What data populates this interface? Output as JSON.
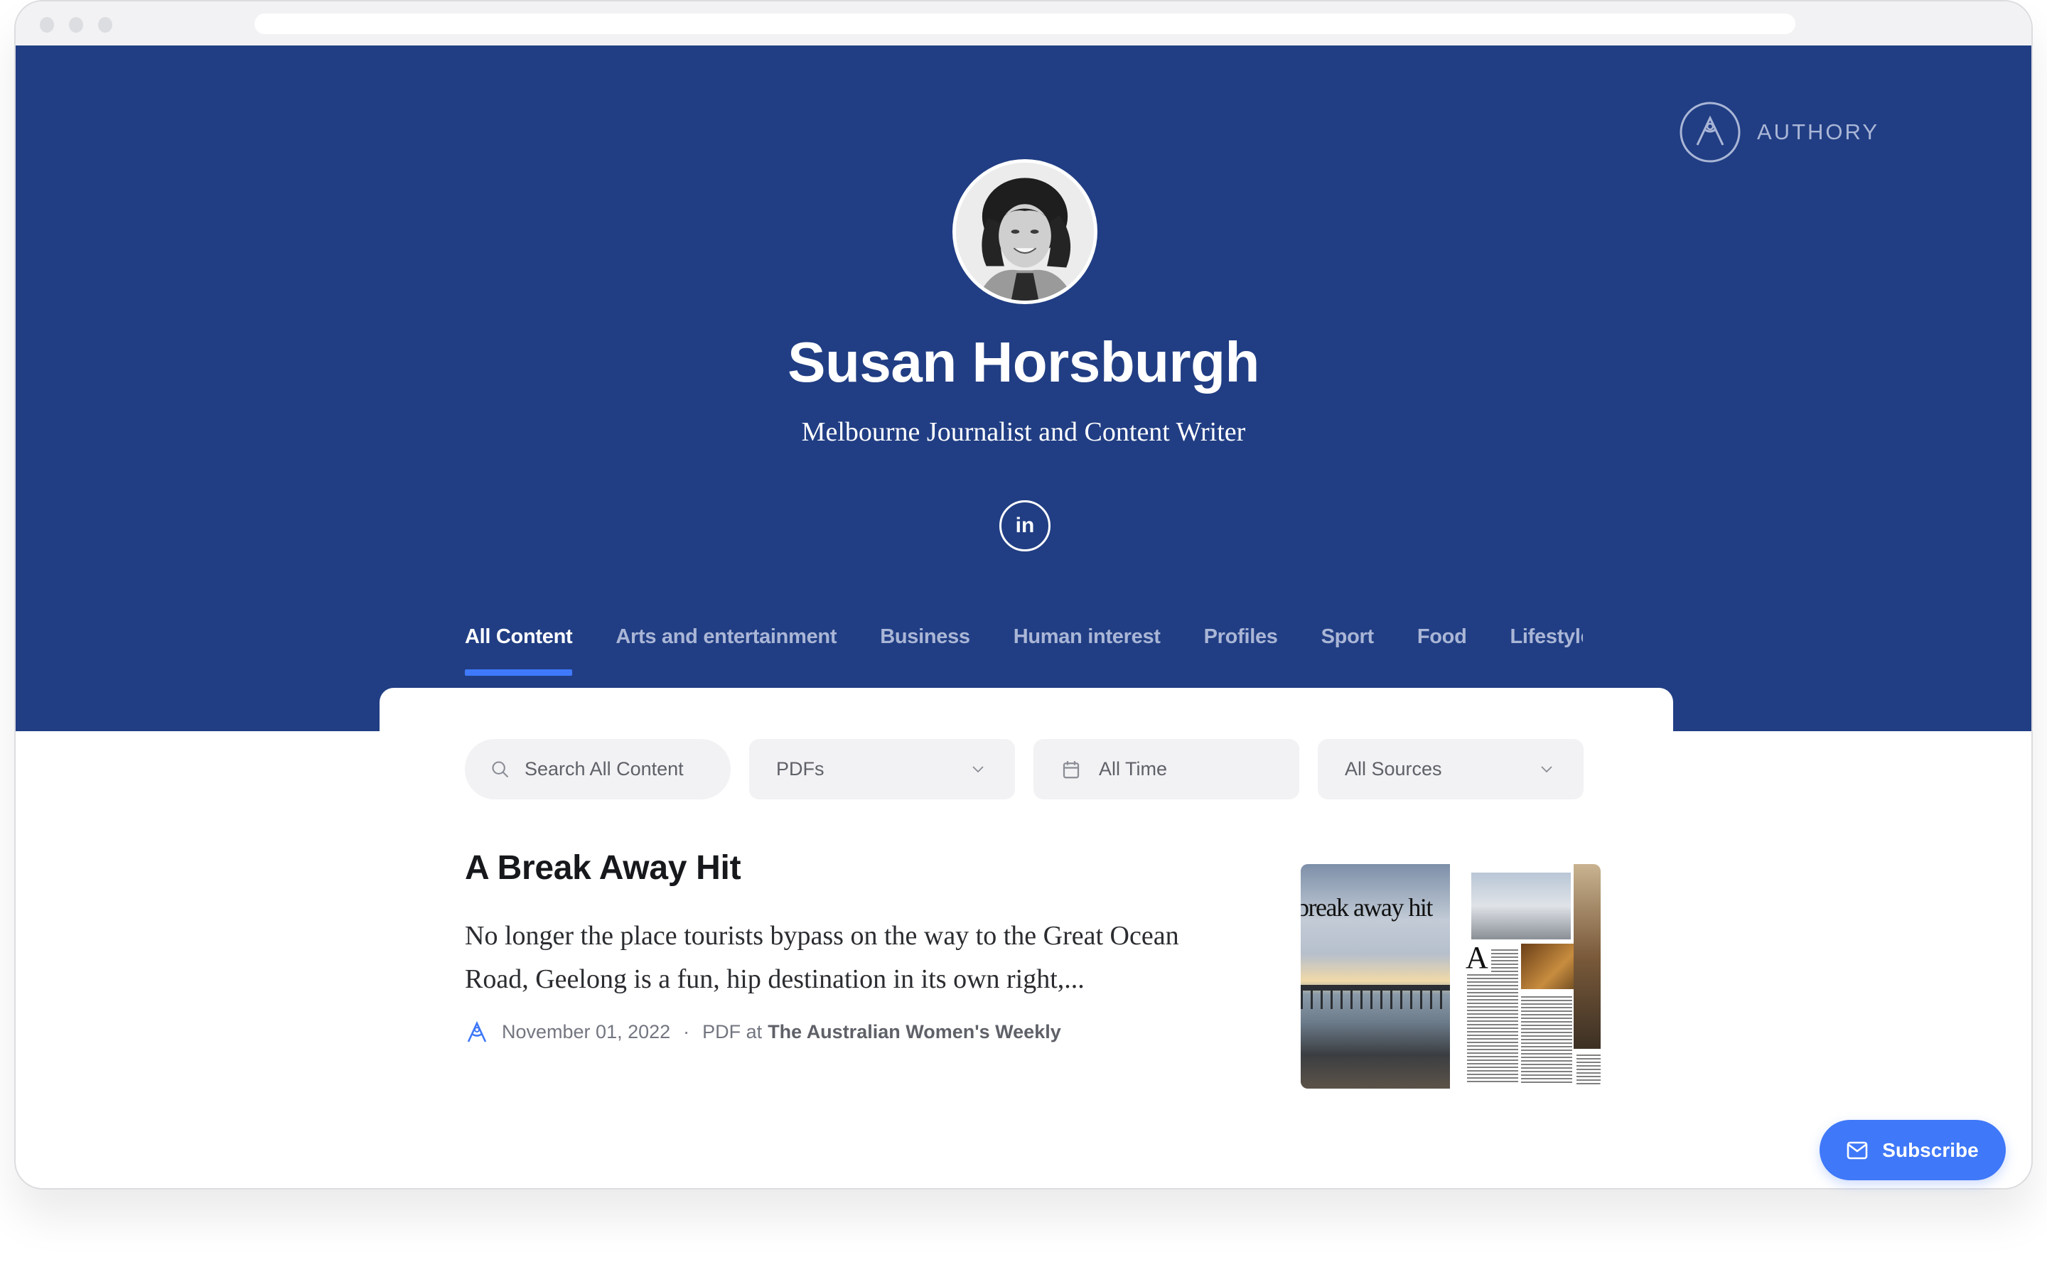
{
  "browser": {
    "address_bar": ""
  },
  "brand": {
    "name": "AUTHORY",
    "icon": "authory-logo-icon"
  },
  "profile": {
    "name": "Susan Horsburgh",
    "tagline": "Melbourne Journalist and Content Writer",
    "avatar_alt": "Susan Horsburgh profile photo",
    "social": [
      {
        "network": "LinkedIn",
        "label": "in",
        "icon": "linkedin-icon"
      }
    ]
  },
  "tabs": [
    {
      "label": "All Content",
      "active": true
    },
    {
      "label": "Arts and entertainment",
      "active": false
    },
    {
      "label": "Business",
      "active": false
    },
    {
      "label": "Human interest",
      "active": false
    },
    {
      "label": "Profiles",
      "active": false
    },
    {
      "label": "Sport",
      "active": false
    },
    {
      "label": "Food",
      "active": false
    },
    {
      "label": "Lifestyle",
      "active": false
    }
  ],
  "filters": {
    "search": {
      "placeholder": "Search All Content",
      "value": "",
      "icon": "search-icon"
    },
    "type": {
      "selected": "PDFs",
      "icon": "chevron-down-icon"
    },
    "time": {
      "selected": "All Time",
      "icon": "calendar-icon"
    },
    "sources": {
      "selected": "All Sources",
      "icon": "chevron-down-icon"
    }
  },
  "articles": [
    {
      "title": "A Break Away Hit",
      "excerpt": "No longer the place tourists bypass on the way to the Great Ocean Road, Geelong is a fun, hip destination in its own right,...",
      "date": "November 01, 2022",
      "separator": "·",
      "format_prefix": "PDF at",
      "source": "The Australian Women's Weekly",
      "thumbnail_headline": "break away hit",
      "thumbnail_dropcap": "A"
    }
  ],
  "subscribe": {
    "label": "Subscribe",
    "icon": "mail-icon"
  },
  "colors": {
    "hero_bg": "#213e84",
    "accent": "#3f78f8",
    "tab_inactive": "#aab6d6",
    "filter_bg": "#f2f2f4"
  }
}
